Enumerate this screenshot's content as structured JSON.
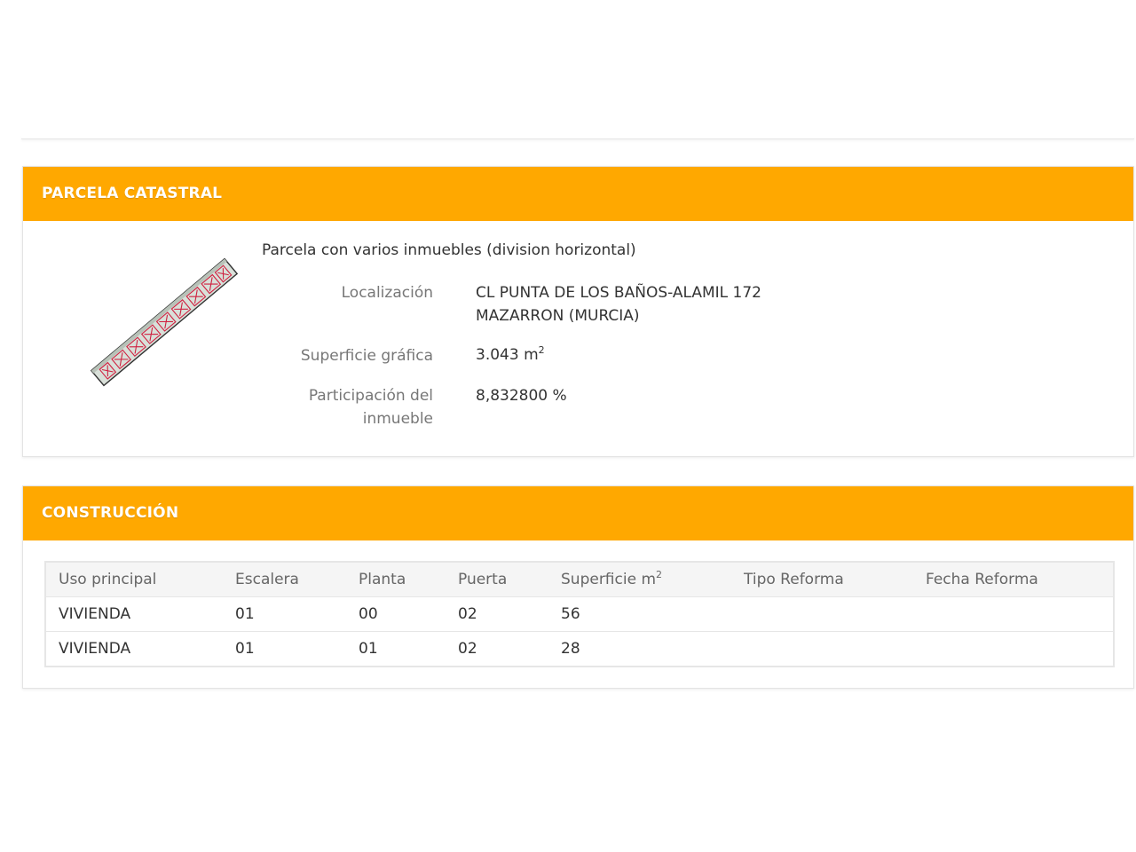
{
  "parcela": {
    "header": "PARCELA CATASTRAL",
    "tipo": "Parcela con varios inmuebles (division horizontal)",
    "localizacion_label": "Localización",
    "localizacion_line1": "CL PUNTA DE LOS BAÑOS-ALAMIL 172",
    "localizacion_line2": "MAZARRON (MURCIA)",
    "superficie_label": "Superficie gráfica",
    "superficie_value": "3.043 m",
    "superficie_unit_sup": "2",
    "participacion_label_1": "Participación del",
    "participacion_label_2": "inmueble",
    "participacion_value": "8,832800 %"
  },
  "construccion": {
    "header": "CONSTRUCCIÓN",
    "columns": {
      "uso": "Uso principal",
      "escalera": "Escalera",
      "planta": "Planta",
      "puerta": "Puerta",
      "superficie": "Superficie m",
      "superficie_sup": "2",
      "tipo_reforma": "Tipo Reforma",
      "fecha_reforma": "Fecha Reforma"
    },
    "rows": [
      {
        "uso": "VIVIENDA",
        "escalera": "01",
        "planta": "00",
        "puerta": "02",
        "superficie": "56",
        "tipo_reforma": "",
        "fecha_reforma": ""
      },
      {
        "uso": "VIVIENDA",
        "escalera": "01",
        "planta": "01",
        "puerta": "02",
        "superficie": "28",
        "tipo_reforma": "",
        "fecha_reforma": ""
      }
    ]
  },
  "colors": {
    "header_bg": "#ffa800",
    "header_text": "#ffffff",
    "label_text": "#777777"
  }
}
